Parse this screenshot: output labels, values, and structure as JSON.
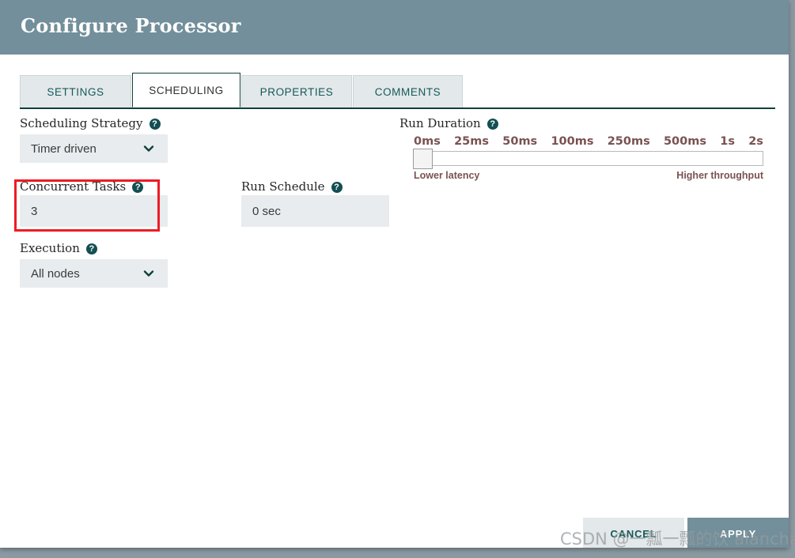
{
  "header": {
    "title": "Configure Processor"
  },
  "tabs": [
    {
      "label": "SETTINGS",
      "active": false,
      "name": "tab-settings"
    },
    {
      "label": "SCHEDULING",
      "active": true,
      "name": "tab-scheduling"
    },
    {
      "label": "PROPERTIES",
      "active": false,
      "name": "tab-properties"
    },
    {
      "label": "COMMENTS",
      "active": false,
      "name": "tab-comments"
    }
  ],
  "form": {
    "scheduling_strategy": {
      "label": "Scheduling Strategy",
      "value": "Timer driven",
      "help_icon": "help-circle-icon",
      "chevron_icon": "chevron-down-icon"
    },
    "concurrent_tasks": {
      "label": "Concurrent Tasks",
      "value": "3",
      "help_icon": "help-circle-icon",
      "highlighted": true,
      "highlight_color": "#ee1b24"
    },
    "execution": {
      "label": "Execution",
      "value": "All nodes",
      "help_icon": "help-circle-icon",
      "chevron_icon": "chevron-down-icon"
    },
    "run_schedule": {
      "label": "Run Schedule",
      "value": "0 sec",
      "help_icon": "help-circle-icon"
    },
    "run_duration": {
      "label": "Run Duration",
      "help_icon": "help-circle-icon",
      "ticks": [
        "0ms",
        "25ms",
        "50ms",
        "100ms",
        "250ms",
        "500ms",
        "1s",
        "2s"
      ],
      "selected_tick": "0ms",
      "left_endpoint_label": "Lower latency",
      "right_endpoint_label": "Higher throughput"
    }
  },
  "footer": {
    "cancel_label": "CANCEL",
    "apply_label": "APPLY"
  },
  "watermark": {
    "text": "CSDN @一瓢一瓢的饮 alanchan"
  },
  "colors": {
    "header_bg": "#728f9b",
    "accent_teal": "#15595b",
    "tick_text": "#7a5252",
    "highlight_red": "#ee1b24",
    "control_bg": "#e8ecee"
  }
}
